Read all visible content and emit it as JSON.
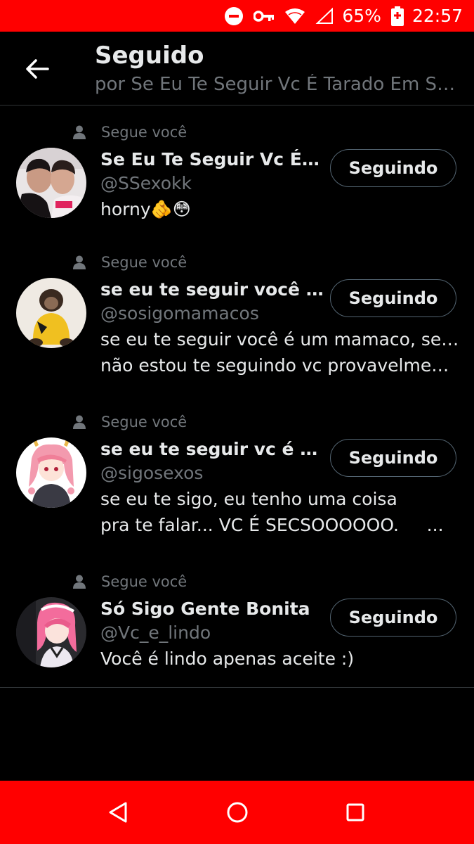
{
  "status_bar": {
    "battery": "65%",
    "time": "22:57",
    "icons": [
      "do-not-disturb-icon",
      "key-icon",
      "wifi-icon",
      "no-signal-icon",
      "battery-icon"
    ]
  },
  "header": {
    "title": "Seguido",
    "subtitle": "por Se Eu Te Seguir Vc É Tarado Em Sexo",
    "back_icon": "arrow-left-icon"
  },
  "users": [
    {
      "follows_you": "Segue você",
      "name": "Se Eu Te Seguir Vc É T...😳",
      "handle": "@SSexokk",
      "bio": [
        "horny🫵😳"
      ],
      "button": "Seguindo"
    },
    {
      "follows_you": "Segue você",
      "name": "se eu te seguir você é u...",
      "handle": "@sosigomamacos",
      "bio": [
        "se eu te seguir você é um mamaco, se eu",
        "não estou te seguindo vc provavelmente é..."
      ],
      "button": "Seguindo"
    },
    {
      "follows_you": "Segue você",
      "name": "se eu te seguir vc é be...",
      "handle": "@sigosexos",
      "bio": [
        "se eu te sigo, eu tenho uma coisa",
        "pra te falar... VC É SECSOOOOOO.     ..."
      ],
      "button": "Seguindo"
    },
    {
      "follows_you": "Segue você",
      "name": "Só Sigo Gente Bonita",
      "handle": "@Vc_e_lindo",
      "bio": [
        "Você é lindo apenas aceite :)"
      ],
      "button": "Seguindo"
    }
  ],
  "nav_bar": {
    "icons": [
      "back-triangle-icon",
      "home-circle-icon",
      "recents-square-icon"
    ]
  },
  "colors": {
    "status_bar": "#ff0000",
    "background": "#000000",
    "secondary_text": "#71767b"
  }
}
